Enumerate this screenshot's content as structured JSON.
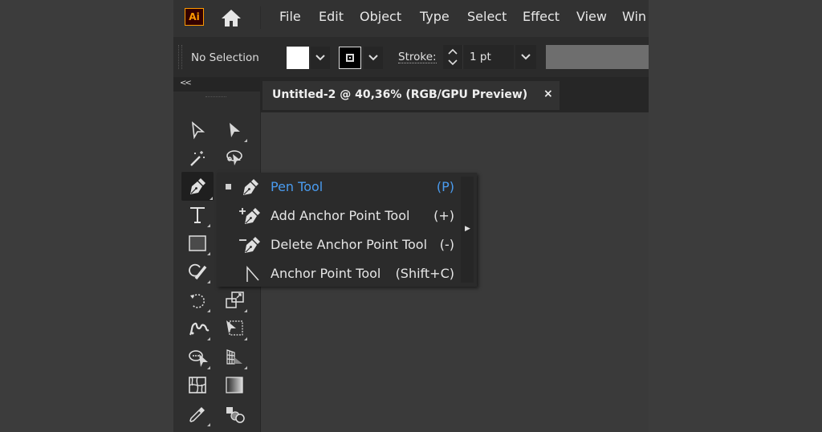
{
  "app": {
    "logo": "Ai",
    "brand_color": "#ff9a00"
  },
  "menubar": {
    "home_icon": "home-icon",
    "items": [
      "File",
      "Edit",
      "Object",
      "Type",
      "Select",
      "Effect",
      "View",
      "Win"
    ]
  },
  "control_bar": {
    "selection_status": "No Selection",
    "fill_color": "#ffffff",
    "stroke_label": "Stroke:",
    "stroke_value": "1 pt"
  },
  "toolbar": {
    "collapse_label": "<<",
    "tools": [
      {
        "name": "selection-tool",
        "icon": "arrow-outline-icon"
      },
      {
        "name": "direct-selection-tool",
        "icon": "arrow-filled-icon"
      },
      {
        "name": "magic-wand-tool",
        "icon": "magic-wand-icon"
      },
      {
        "name": "lasso-tool",
        "icon": "lasso-icon"
      },
      {
        "name": "pen-tool",
        "icon": "pen-icon",
        "active": true
      },
      {
        "name": "type-tool",
        "icon": "type-icon"
      },
      {
        "name": "rectangle-tool",
        "icon": "rectangle-icon"
      },
      {
        "name": "shaper-tool",
        "icon": "shaper-icon"
      },
      {
        "name": "rotate-tool",
        "icon": "rotate-icon"
      },
      {
        "name": "scale-tool",
        "icon": "scale-icon"
      },
      {
        "name": "puppet-warp-tool",
        "icon": "puppet-warp-icon"
      },
      {
        "name": "free-transform-tool",
        "icon": "free-transform-icon"
      },
      {
        "name": "shape-builder-tool",
        "icon": "shape-builder-icon"
      },
      {
        "name": "perspective-grid-tool",
        "icon": "perspective-grid-icon"
      },
      {
        "name": "mesh-tool",
        "icon": "mesh-icon"
      },
      {
        "name": "gradient-tool",
        "icon": "gradient-icon"
      },
      {
        "name": "eyedropper-tool",
        "icon": "eyedropper-icon"
      },
      {
        "name": "blend-tool",
        "icon": "blend-icon"
      }
    ]
  },
  "document": {
    "tab_title": "Untitled-2 @ 40,36% (RGB/GPU Preview)",
    "close_label": "×"
  },
  "flyout": {
    "selected_color": "#4a9cf0",
    "items": [
      {
        "label": "Pen Tool",
        "shortcut": "(P)",
        "selected": true
      },
      {
        "label": "Add Anchor Point Tool",
        "shortcut": "(+)"
      },
      {
        "label": "Delete Anchor Point Tool",
        "shortcut": "(-)"
      },
      {
        "label": "Anchor Point Tool",
        "shortcut": "(Shift+C)"
      }
    ]
  }
}
